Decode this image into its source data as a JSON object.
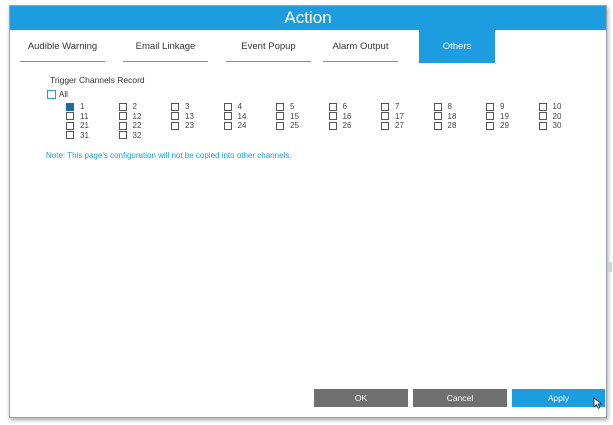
{
  "dialog": {
    "title": "Action"
  },
  "tabs": [
    {
      "label": "Audible Warning",
      "active": false
    },
    {
      "label": "Email Linkage",
      "active": false
    },
    {
      "label": "Event Popup",
      "active": false
    },
    {
      "label": "Alarm Output",
      "active": false
    },
    {
      "label": "Others",
      "active": true
    }
  ],
  "section": {
    "title": "Trigger Channels Record",
    "all_label": "All",
    "all_checked": false
  },
  "channels": [
    {
      "label": "1",
      "checked": true
    },
    {
      "label": "2",
      "checked": false
    },
    {
      "label": "3",
      "checked": false
    },
    {
      "label": "4",
      "checked": false
    },
    {
      "label": "5",
      "checked": false
    },
    {
      "label": "6",
      "checked": false
    },
    {
      "label": "7",
      "checked": false
    },
    {
      "label": "8",
      "checked": false
    },
    {
      "label": "9",
      "checked": false
    },
    {
      "label": "10",
      "checked": false
    },
    {
      "label": "11",
      "checked": false
    },
    {
      "label": "12",
      "checked": false
    },
    {
      "label": "13",
      "checked": false
    },
    {
      "label": "14",
      "checked": false
    },
    {
      "label": "15",
      "checked": false
    },
    {
      "label": "16",
      "checked": false
    },
    {
      "label": "17",
      "checked": false
    },
    {
      "label": "18",
      "checked": false
    },
    {
      "label": "19",
      "checked": false
    },
    {
      "label": "20",
      "checked": false
    },
    {
      "label": "21",
      "checked": false
    },
    {
      "label": "22",
      "checked": false
    },
    {
      "label": "23",
      "checked": false
    },
    {
      "label": "24",
      "checked": false
    },
    {
      "label": "25",
      "checked": false
    },
    {
      "label": "26",
      "checked": false
    },
    {
      "label": "27",
      "checked": false
    },
    {
      "label": "28",
      "checked": false
    },
    {
      "label": "29",
      "checked": false
    },
    {
      "label": "30",
      "checked": false
    },
    {
      "label": "31",
      "checked": false
    },
    {
      "label": "32",
      "checked": false
    }
  ],
  "note": "Note: This page's configuration will not be copied into other channels.",
  "footer": {
    "ok_label": "OK",
    "cancel_label": "Cancel",
    "apply_label": "Apply"
  },
  "colors": {
    "accent": "#1e9ce0",
    "button_gray": "#707070",
    "checked": "#1a6e99"
  },
  "icons": {
    "cursor": "mouse-pointer-icon"
  }
}
